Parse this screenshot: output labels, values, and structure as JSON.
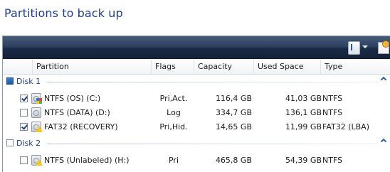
{
  "page": {
    "title": "Partitions to back up"
  },
  "columns": [
    "Partition",
    "Flags",
    "Capacity",
    "Used Space",
    "Type"
  ],
  "groups": [
    {
      "label": "Disk 1",
      "checked": true,
      "rows": [
        {
          "checked": true,
          "icon": "os-drive-icon",
          "name": "NTFS (OS) (C:)",
          "flags": "Pri,Act.",
          "capacity": "116,4 GB",
          "used": "41,03 GB",
          "type": "NTFS"
        },
        {
          "checked": false,
          "icon": "drive-icon",
          "name": "NTFS (DATA) (D:)",
          "flags": "Log",
          "capacity": "334,7 GB",
          "used": "136,1 GB",
          "type": "NTFS"
        },
        {
          "checked": true,
          "icon": "warning-drive-icon",
          "name": "FAT32 (RECOVERY)",
          "flags": "Pri,Hid.",
          "capacity": "14,65 GB",
          "used": "11,99 GB",
          "type": "FAT32 (LBA)"
        }
      ]
    },
    {
      "label": "Disk 2",
      "checked": false,
      "rows": [
        {
          "checked": false,
          "icon": "warning-drive-icon",
          "name": "NTFS (Unlabeled) (H:)",
          "flags": "Pri",
          "capacity": "465,8 GB",
          "used": "54,39 GB",
          "type": "NTFS"
        }
      ]
    }
  ],
  "colors": {
    "toolbar": "#2d415f",
    "group_text": "#1e3c8c",
    "title_text": "#1e3c8c"
  }
}
